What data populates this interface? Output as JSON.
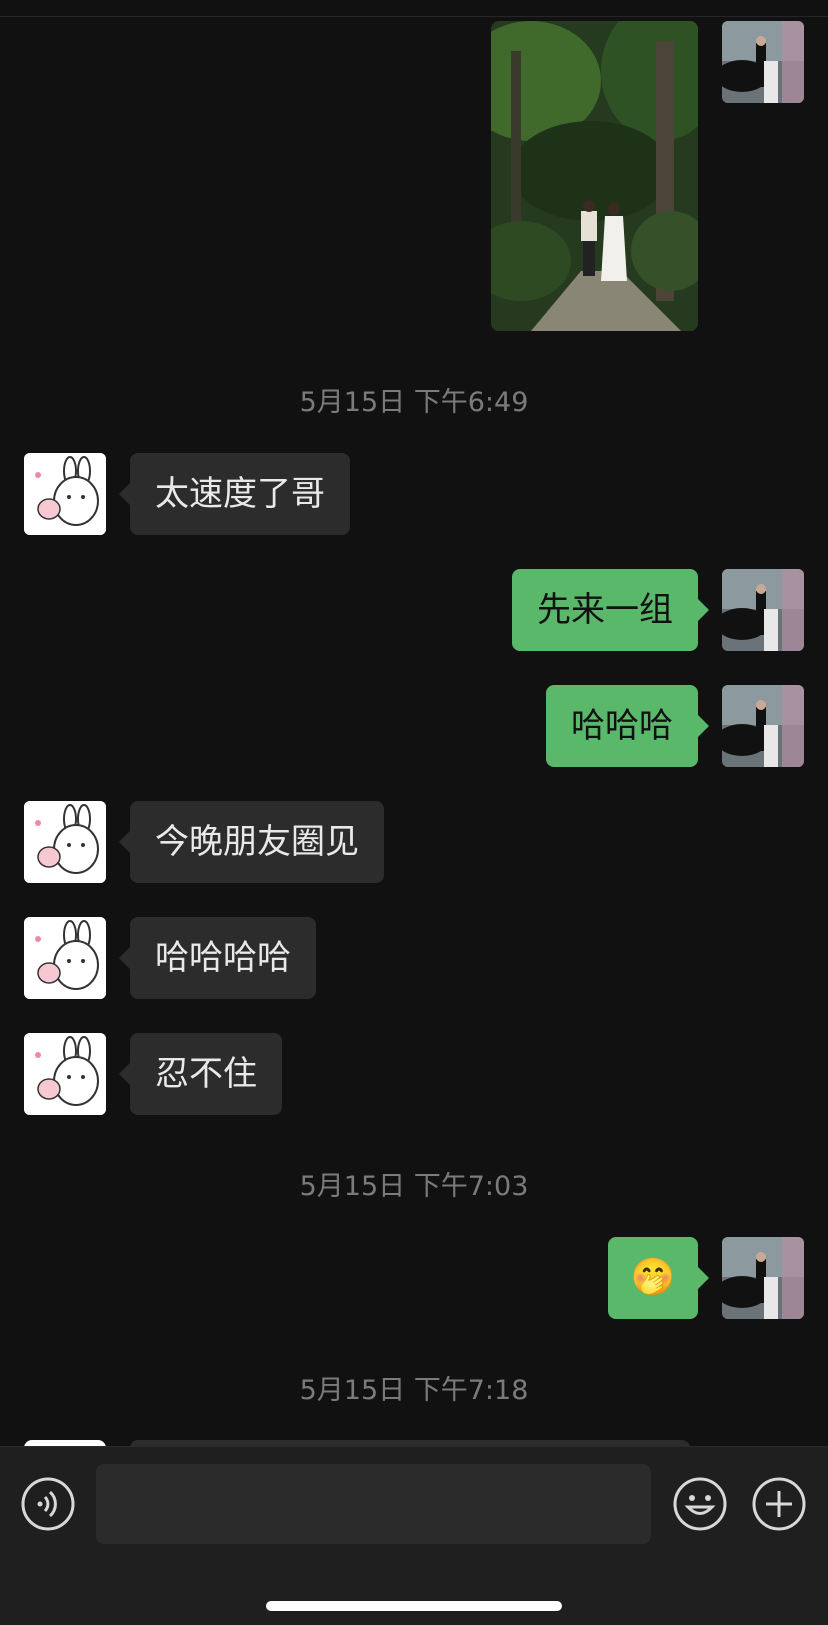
{
  "messages": [
    {
      "kind": "image",
      "side": "right"
    },
    {
      "kind": "timestamp",
      "text": "5月15日 下午6:49"
    },
    {
      "kind": "text",
      "side": "left",
      "text": "太速度了哥"
    },
    {
      "kind": "text",
      "side": "right",
      "text": "先来一组"
    },
    {
      "kind": "text",
      "side": "right",
      "text": "哈哈哈"
    },
    {
      "kind": "text",
      "side": "left",
      "text": "今晚朋友圈见"
    },
    {
      "kind": "text",
      "side": "left",
      "text": "哈哈哈哈"
    },
    {
      "kind": "text",
      "side": "left",
      "text": "忍不住"
    },
    {
      "kind": "timestamp",
      "text": "5月15日 下午7:03"
    },
    {
      "kind": "emoji",
      "side": "right",
      "text": "🤭"
    },
    {
      "kind": "timestamp",
      "text": "5月15日 下午7:18"
    }
  ],
  "input": {
    "placeholder": ""
  },
  "icons": {
    "voice": "voice-icon",
    "emoji": "emoji-icon",
    "more": "plus-icon"
  },
  "colors": {
    "background": "#111111",
    "incoming_bubble": "#2c2c2c",
    "outgoing_bubble": "#5ab86a"
  }
}
